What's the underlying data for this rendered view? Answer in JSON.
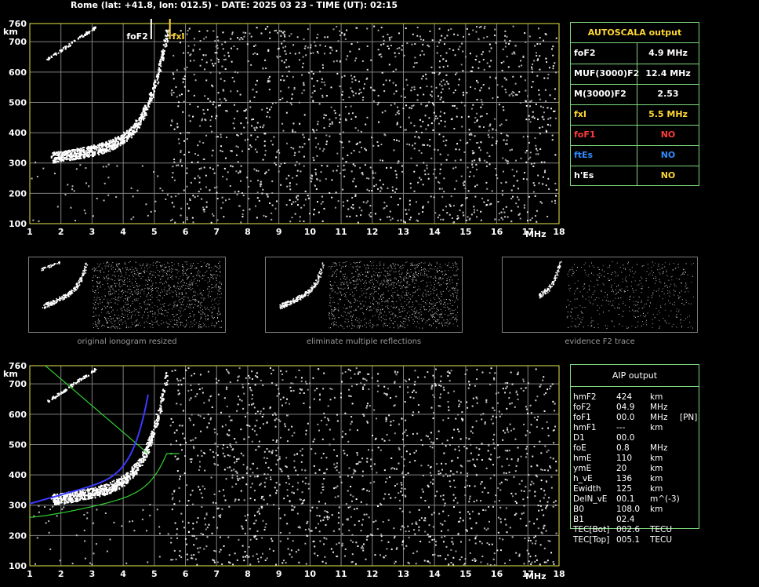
{
  "header": {
    "title": "Rome (lat: +41.8, lon: 012.5) - DATE: 2025 03 23 - TIME (UT): 02:15"
  },
  "colors": {
    "background": "#000000",
    "grid": "#808080",
    "plot_frame": "#e8e84a",
    "box_border": "#7cd87c",
    "label_yellow": "#ffd733",
    "label_red": "#ff3b3b",
    "label_blue": "#2f8cff",
    "trace_blue": "#3a3aff",
    "curve_green": "#2fd12f"
  },
  "ionogram_top": {
    "y_unit": "km",
    "x_unit": "MHz",
    "y_ticks": [
      "100",
      "200",
      "300",
      "400",
      "500",
      "600",
      "700",
      "760"
    ],
    "x_ticks": [
      "1",
      "2",
      "3",
      "4",
      "5",
      "6",
      "7",
      "8",
      "9",
      "10",
      "11",
      "12",
      "13",
      "14",
      "15",
      "16",
      "17",
      "18"
    ],
    "markers": [
      {
        "label": "foF2",
        "freq_mhz": 4.9,
        "color": "#ffffff"
      },
      {
        "label": "fxI",
        "freq_mhz": 5.5,
        "color": "#ffd733"
      }
    ]
  },
  "ionogram_bottom": {
    "y_unit": "km",
    "x_unit": "MHz",
    "y_ticks": [
      "100",
      "200",
      "300",
      "400",
      "500",
      "600",
      "700",
      "760"
    ],
    "x_ticks": [
      "1",
      "2",
      "3",
      "4",
      "5",
      "6",
      "7",
      "8",
      "9",
      "10",
      "11",
      "12",
      "13",
      "14",
      "15",
      "16",
      "17",
      "18"
    ]
  },
  "thumbnails": [
    {
      "caption": "original ionogram resized"
    },
    {
      "caption": "eliminate multiple reflections"
    },
    {
      "caption": "evidence F2 trace"
    }
  ],
  "autoscala": {
    "title": "AUTOSCALA output",
    "rows": [
      {
        "key": "foF2",
        "value": "4.9 MHz",
        "key_color": "#ffffff",
        "value_color": "#ffffff"
      },
      {
        "key": "MUF(3000)F2",
        "value": "12.4 MHz",
        "key_color": "#ffffff",
        "value_color": "#ffffff"
      },
      {
        "key": "M(3000)F2",
        "value": "2.53",
        "key_color": "#ffffff",
        "value_color": "#ffffff"
      },
      {
        "key": "fxI",
        "value": "5.5 MHz",
        "key_color": "#ffd733",
        "value_color": "#ffd733"
      },
      {
        "key": "foF1",
        "value": "NO",
        "key_color": "#ff3b3b",
        "value_color": "#ff3b3b"
      },
      {
        "key": "ftEs",
        "value": "NO",
        "key_color": "#2f8cff",
        "value_color": "#2f8cff"
      },
      {
        "key": "h'Es",
        "value": "NO",
        "key_color": "#ffffff",
        "value_color": "#ffd733"
      }
    ]
  },
  "aip": {
    "title": "AIP output",
    "rows": [
      {
        "key": "hmF2",
        "value": "424",
        "unit": "km",
        "extra": ""
      },
      {
        "key": "foF2",
        "value": "04.9",
        "unit": "MHz",
        "extra": ""
      },
      {
        "key": "foF1",
        "value": "00.0",
        "unit": "MHz",
        "extra": "[PN]"
      },
      {
        "key": "hmF1",
        "value": "---",
        "unit": "km",
        "extra": ""
      },
      {
        "key": "D1",
        "value": "00.0",
        "unit": "",
        "extra": ""
      },
      {
        "key": "foE",
        "value": "0.8",
        "unit": "MHz",
        "extra": ""
      },
      {
        "key": "hmE",
        "value": "110",
        "unit": "km",
        "extra": ""
      },
      {
        "key": "ymE",
        "value": "20",
        "unit": "km",
        "extra": ""
      },
      {
        "key": "h_vE",
        "value": "136",
        "unit": "km",
        "extra": ""
      },
      {
        "key": "Ewidth",
        "value": "125",
        "unit": "km",
        "extra": ""
      },
      {
        "key": "DelN_vE",
        "value": "00.1",
        "unit": "m^(-3)",
        "extra": ""
      },
      {
        "key": "B0",
        "value": "108.0",
        "unit": "km",
        "extra": ""
      },
      {
        "key": "B1",
        "value": "02.4",
        "unit": "",
        "extra": ""
      },
      {
        "key": "TEC[Bot]",
        "value": "002.6",
        "unit": "TECU",
        "extra": ""
      },
      {
        "key": "TEC[Top]",
        "value": "005.1",
        "unit": "TECU",
        "extra": ""
      }
    ]
  }
}
